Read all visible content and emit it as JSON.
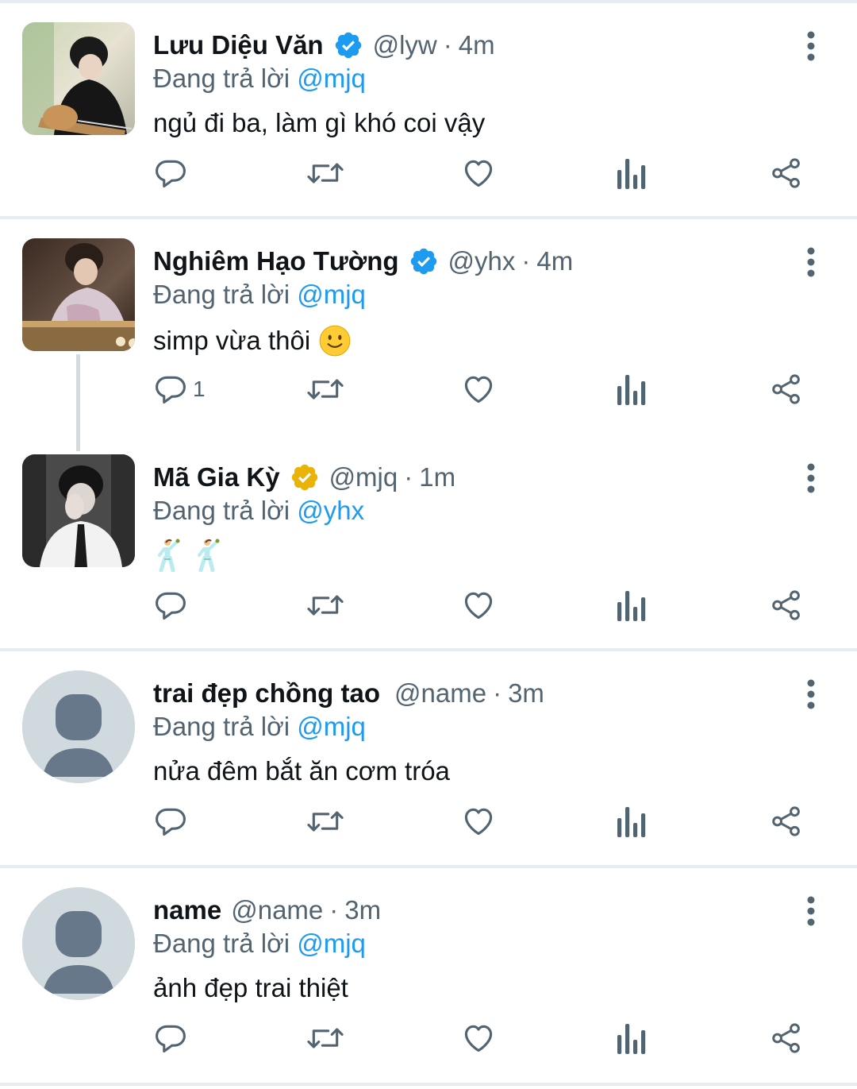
{
  "colors": {
    "accent": "#1d9bf0",
    "icon": "#536471",
    "gold_badge": "#e9b308"
  },
  "tweets": [
    {
      "name": "Lưu Diệu Văn",
      "verified": "blue-check-icon",
      "handle": "@lyw",
      "dot": "·",
      "time": "4m",
      "reply_prefix": "Đang trả lời",
      "reply_to": "@mjq",
      "text": "ngủ đi ba, làm gì khó coi vậy",
      "reply_count": ""
    },
    {
      "name": "Nghiêm Hạo Tường",
      "verified": "blue-check-icon",
      "handle": "@yhx",
      "dot": "·",
      "time": "4m",
      "reply_prefix": "Đang trả lời",
      "reply_to": "@mjq",
      "text": "simp vừa thôi",
      "emoji": "slightly-smiling-face-icon",
      "reply_count": "1"
    },
    {
      "name": "Mã Gia Kỳ",
      "verified": "gold-check-icon",
      "handle": "@mjq",
      "dot": "·",
      "time": "1m",
      "reply_prefix": "Đang trả lời",
      "reply_to": "@yhx",
      "emoji": "man-dancing-icon",
      "reply_count": ""
    },
    {
      "name": "trai đẹp chồng tao",
      "handle": "@name",
      "dot": "·",
      "time": "3m",
      "reply_prefix": "Đang trả lời",
      "reply_to": "@mjq",
      "text": "nửa đêm bắt ăn cơm tróa",
      "reply_count": ""
    },
    {
      "name": "name",
      "handle": "@name",
      "dot": "·",
      "time": "3m",
      "reply_prefix": "Đang trả lời",
      "reply_to": "@mjq",
      "text": "ảnh đẹp trai thiệt",
      "reply_count": ""
    }
  ]
}
